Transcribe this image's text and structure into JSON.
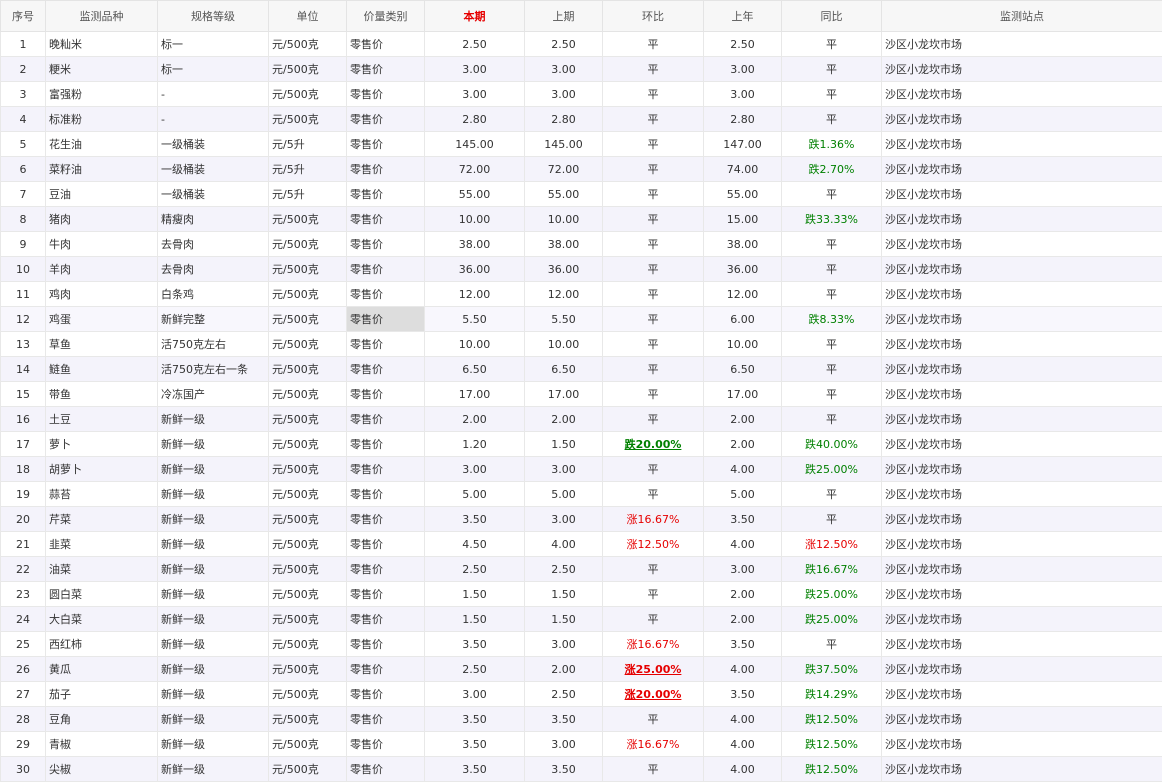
{
  "headers": [
    "序号",
    "监测品种",
    "规格等级",
    "单位",
    "价量类别",
    "本期",
    "上期",
    "环比",
    "上年",
    "同比",
    "监测站点"
  ],
  "rows": [
    {
      "no": "1",
      "name": "晚籼米",
      "spec": "标一",
      "unit": "元/500克",
      "type": "零售价",
      "cur": "2.50",
      "prev": "2.50",
      "mom": "平",
      "lastyear": "2.50",
      "yoy": "平",
      "site": "沙区小龙坎市场"
    },
    {
      "no": "2",
      "name": "粳米",
      "spec": "标一",
      "unit": "元/500克",
      "type": "零售价",
      "cur": "3.00",
      "prev": "3.00",
      "mom": "平",
      "lastyear": "3.00",
      "yoy": "平",
      "site": "沙区小龙坎市场"
    },
    {
      "no": "3",
      "name": "富强粉",
      "spec": "-",
      "unit": "元/500克",
      "type": "零售价",
      "cur": "3.00",
      "prev": "3.00",
      "mom": "平",
      "lastyear": "3.00",
      "yoy": "平",
      "site": "沙区小龙坎市场"
    },
    {
      "no": "4",
      "name": "标准粉",
      "spec": "-",
      "unit": "元/500克",
      "type": "零售价",
      "cur": "2.80",
      "prev": "2.80",
      "mom": "平",
      "lastyear": "2.80",
      "yoy": "平",
      "site": "沙区小龙坎市场"
    },
    {
      "no": "5",
      "name": "花生油",
      "spec": "一级桶装",
      "unit": "元/5升",
      "type": "零售价",
      "cur": "145.00",
      "prev": "145.00",
      "mom": "平",
      "lastyear": "147.00",
      "yoy": "跌1.36%",
      "site": "沙区小龙坎市场"
    },
    {
      "no": "6",
      "name": "菜籽油",
      "spec": "一级桶装",
      "unit": "元/5升",
      "type": "零售价",
      "cur": "72.00",
      "prev": "72.00",
      "mom": "平",
      "lastyear": "74.00",
      "yoy": "跌2.70%",
      "site": "沙区小龙坎市场"
    },
    {
      "no": "7",
      "name": "豆油",
      "spec": "一级桶装",
      "unit": "元/5升",
      "type": "零售价",
      "cur": "55.00",
      "prev": "55.00",
      "mom": "平",
      "lastyear": "55.00",
      "yoy": "平",
      "site": "沙区小龙坎市场"
    },
    {
      "no": "8",
      "name": "猪肉",
      "spec": "精瘦肉",
      "unit": "元/500克",
      "type": "零售价",
      "cur": "10.00",
      "prev": "10.00",
      "mom": "平",
      "lastyear": "15.00",
      "yoy": "跌33.33%",
      "site": "沙区小龙坎市场"
    },
    {
      "no": "9",
      "name": "牛肉",
      "spec": "去骨肉",
      "unit": "元/500克",
      "type": "零售价",
      "cur": "38.00",
      "prev": "38.00",
      "mom": "平",
      "lastyear": "38.00",
      "yoy": "平",
      "site": "沙区小龙坎市场"
    },
    {
      "no": "10",
      "name": "羊肉",
      "spec": "去骨肉",
      "unit": "元/500克",
      "type": "零售价",
      "cur": "36.00",
      "prev": "36.00",
      "mom": "平",
      "lastyear": "36.00",
      "yoy": "平",
      "site": "沙区小龙坎市场"
    },
    {
      "no": "11",
      "name": "鸡肉",
      "spec": "白条鸡",
      "unit": "元/500克",
      "type": "零售价",
      "cur": "12.00",
      "prev": "12.00",
      "mom": "平",
      "lastyear": "12.00",
      "yoy": "平",
      "site": "沙区小龙坎市场"
    },
    {
      "no": "12",
      "name": "鸡蛋",
      "spec": "新鲜完整",
      "unit": "元/500克",
      "type": "零售价",
      "cur": "5.50",
      "prev": "5.50",
      "mom": "平",
      "lastyear": "6.00",
      "yoy": "跌8.33%",
      "site": "沙区小龙坎市场"
    },
    {
      "no": "13",
      "name": "草鱼",
      "spec": "活750克左右",
      "unit": "元/500克",
      "type": "零售价",
      "cur": "10.00",
      "prev": "10.00",
      "mom": "平",
      "lastyear": "10.00",
      "yoy": "平",
      "site": "沙区小龙坎市场"
    },
    {
      "no": "14",
      "name": "鲢鱼",
      "spec": "活750克左右一条",
      "unit": "元/500克",
      "type": "零售价",
      "cur": "6.50",
      "prev": "6.50",
      "mom": "平",
      "lastyear": "6.50",
      "yoy": "平",
      "site": "沙区小龙坎市场"
    },
    {
      "no": "15",
      "name": "带鱼",
      "spec": "冷冻国产",
      "unit": "元/500克",
      "type": "零售价",
      "cur": "17.00",
      "prev": "17.00",
      "mom": "平",
      "lastyear": "17.00",
      "yoy": "平",
      "site": "沙区小龙坎市场"
    },
    {
      "no": "16",
      "name": "土豆",
      "spec": "新鲜一级",
      "unit": "元/500克",
      "type": "零售价",
      "cur": "2.00",
      "prev": "2.00",
      "mom": "平",
      "lastyear": "2.00",
      "yoy": "平",
      "site": "沙区小龙坎市场"
    },
    {
      "no": "17",
      "name": "萝卜",
      "spec": "新鲜一级",
      "unit": "元/500克",
      "type": "零售价",
      "cur": "1.20",
      "prev": "1.50",
      "mom": "跌20.00%",
      "lastyear": "2.00",
      "yoy": "跌40.00%",
      "site": "沙区小龙坎市场"
    },
    {
      "no": "18",
      "name": "胡萝卜",
      "spec": "新鲜一级",
      "unit": "元/500克",
      "type": "零售价",
      "cur": "3.00",
      "prev": "3.00",
      "mom": "平",
      "lastyear": "4.00",
      "yoy": "跌25.00%",
      "site": "沙区小龙坎市场"
    },
    {
      "no": "19",
      "name": "蒜苔",
      "spec": "新鲜一级",
      "unit": "元/500克",
      "type": "零售价",
      "cur": "5.00",
      "prev": "5.00",
      "mom": "平",
      "lastyear": "5.00",
      "yoy": "平",
      "site": "沙区小龙坎市场"
    },
    {
      "no": "20",
      "name": "芹菜",
      "spec": "新鲜一级",
      "unit": "元/500克",
      "type": "零售价",
      "cur": "3.50",
      "prev": "3.00",
      "mom": "涨16.67%",
      "lastyear": "3.50",
      "yoy": "平",
      "site": "沙区小龙坎市场"
    },
    {
      "no": "21",
      "name": "韭菜",
      "spec": "新鲜一级",
      "unit": "元/500克",
      "type": "零售价",
      "cur": "4.50",
      "prev": "4.00",
      "mom": "涨12.50%",
      "lastyear": "4.00",
      "yoy": "涨12.50%",
      "site": "沙区小龙坎市场"
    },
    {
      "no": "22",
      "name": "油菜",
      "spec": "新鲜一级",
      "unit": "元/500克",
      "type": "零售价",
      "cur": "2.50",
      "prev": "2.50",
      "mom": "平",
      "lastyear": "3.00",
      "yoy": "跌16.67%",
      "site": "沙区小龙坎市场"
    },
    {
      "no": "23",
      "name": "圆白菜",
      "spec": "新鲜一级",
      "unit": "元/500克",
      "type": "零售价",
      "cur": "1.50",
      "prev": "1.50",
      "mom": "平",
      "lastyear": "2.00",
      "yoy": "跌25.00%",
      "site": "沙区小龙坎市场"
    },
    {
      "no": "24",
      "name": "大白菜",
      "spec": "新鲜一级",
      "unit": "元/500克",
      "type": "零售价",
      "cur": "1.50",
      "prev": "1.50",
      "mom": "平",
      "lastyear": "2.00",
      "yoy": "跌25.00%",
      "site": "沙区小龙坎市场"
    },
    {
      "no": "25",
      "name": "西红柿",
      "spec": "新鲜一级",
      "unit": "元/500克",
      "type": "零售价",
      "cur": "3.50",
      "prev": "3.00",
      "mom": "涨16.67%",
      "lastyear": "3.50",
      "yoy": "平",
      "site": "沙区小龙坎市场"
    },
    {
      "no": "26",
      "name": "黄瓜",
      "spec": "新鲜一级",
      "unit": "元/500克",
      "type": "零售价",
      "cur": "2.50",
      "prev": "2.00",
      "mom": "涨25.00%",
      "lastyear": "4.00",
      "yoy": "跌37.50%",
      "site": "沙区小龙坎市场"
    },
    {
      "no": "27",
      "name": "茄子",
      "spec": "新鲜一级",
      "unit": "元/500克",
      "type": "零售价",
      "cur": "3.00",
      "prev": "2.50",
      "mom": "涨20.00%",
      "lastyear": "3.50",
      "yoy": "跌14.29%",
      "site": "沙区小龙坎市场"
    },
    {
      "no": "28",
      "name": "豆角",
      "spec": "新鲜一级",
      "unit": "元/500克",
      "type": "零售价",
      "cur": "3.50",
      "prev": "3.50",
      "mom": "平",
      "lastyear": "4.00",
      "yoy": "跌12.50%",
      "site": "沙区小龙坎市场"
    },
    {
      "no": "29",
      "name": "青椒",
      "spec": "新鲜一级",
      "unit": "元/500克",
      "type": "零售价",
      "cur": "3.50",
      "prev": "3.00",
      "mom": "涨16.67%",
      "lastyear": "4.00",
      "yoy": "跌12.50%",
      "site": "沙区小龙坎市场"
    },
    {
      "no": "30",
      "name": "尖椒",
      "spec": "新鲜一级",
      "unit": "元/500克",
      "type": "零售价",
      "cur": "3.50",
      "prev": "3.50",
      "mom": "平",
      "lastyear": "4.00",
      "yoy": "跌12.50%",
      "site": "沙区小龙坎市场"
    }
  ],
  "colors": {
    "up": "#e60000",
    "down": "#008000",
    "header_highlight": "#e60000",
    "row_alt": "#f4f3fb"
  }
}
